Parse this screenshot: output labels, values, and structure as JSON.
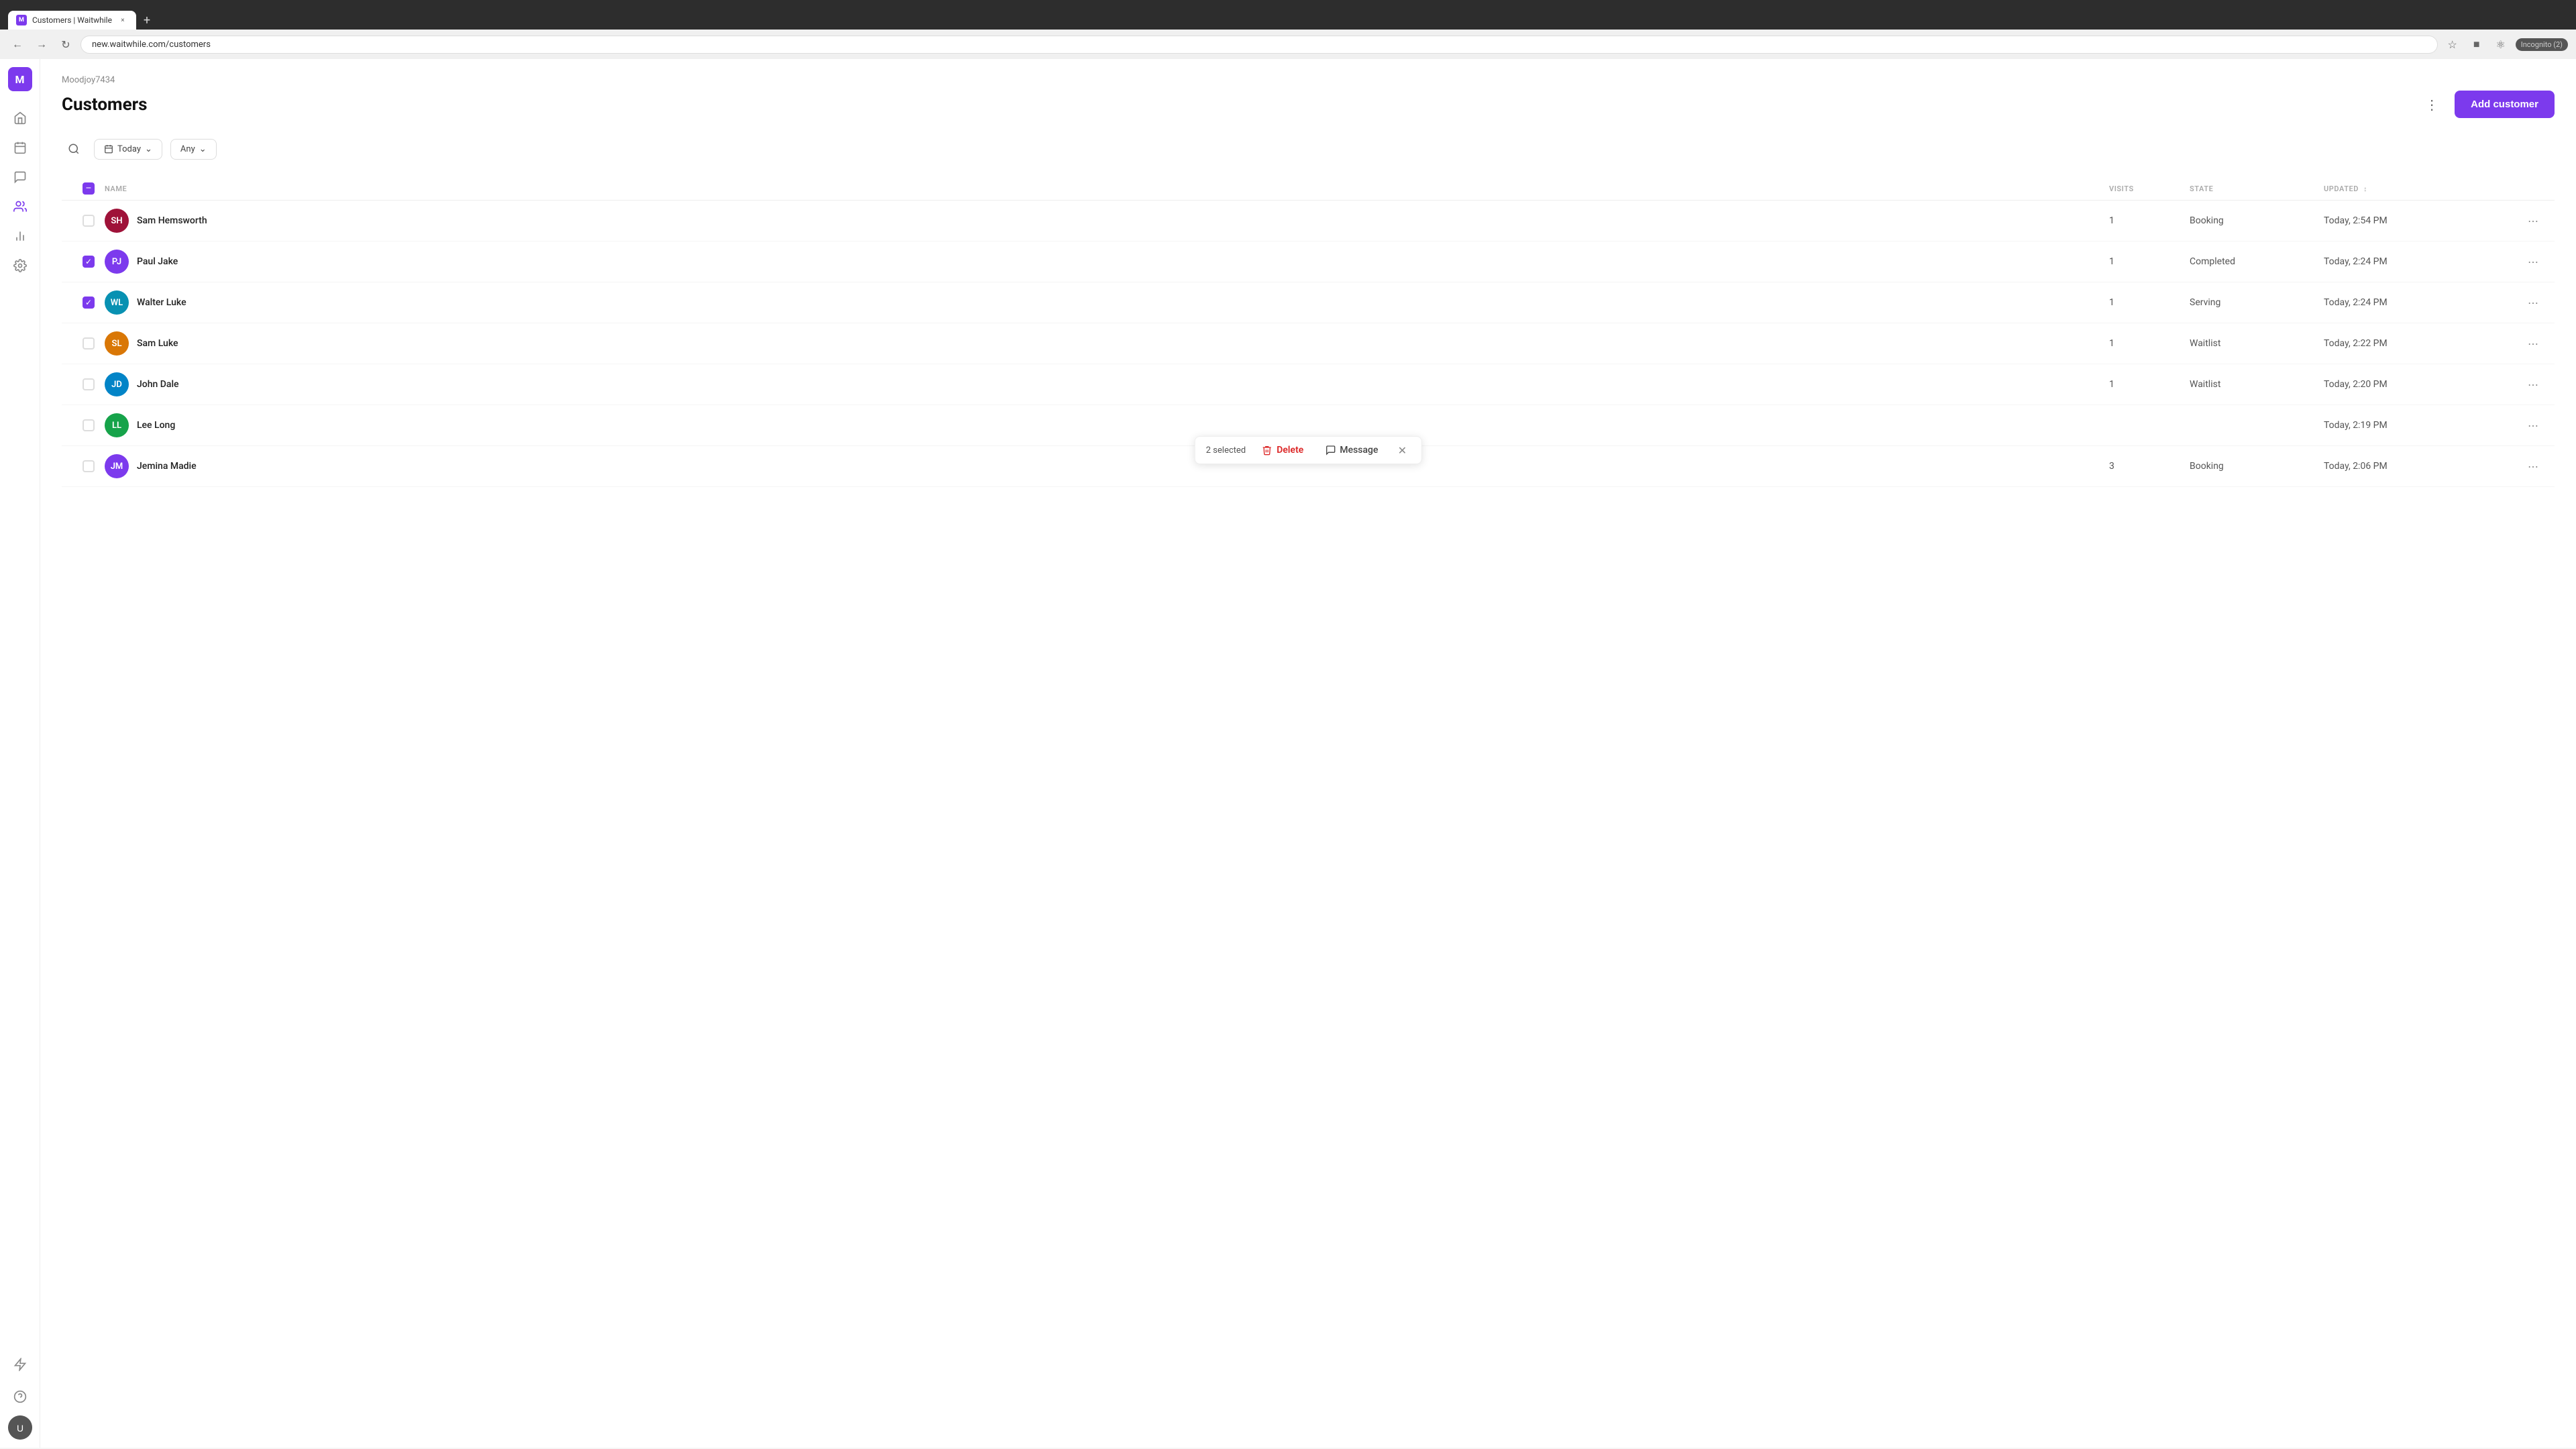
{
  "browser": {
    "tab_title": "Customers | Waitwhile",
    "tab_favicon": "M",
    "new_tab_label": "+",
    "address": "new.waitwhile.com/customers",
    "window_minimize": "—",
    "window_maximize": "□",
    "window_close": "×",
    "incognito_label": "Incognito (2)"
  },
  "workspace": {
    "label": "Moodjoy7434",
    "logo": "M"
  },
  "sidebar": {
    "items": [
      {
        "name": "home",
        "icon": "⌂",
        "active": false
      },
      {
        "name": "calendar",
        "icon": "▦",
        "active": false
      },
      {
        "name": "chat",
        "icon": "💬",
        "active": false
      },
      {
        "name": "customers",
        "icon": "👥",
        "active": true
      },
      {
        "name": "analytics",
        "icon": "📊",
        "active": false
      },
      {
        "name": "settings",
        "icon": "⚙",
        "active": false
      },
      {
        "name": "lightning",
        "icon": "⚡",
        "active": false
      },
      {
        "name": "help",
        "icon": "?",
        "active": false
      }
    ]
  },
  "page": {
    "title": "Customers",
    "add_customer_label": "Add customer"
  },
  "filters": {
    "search_placeholder": "Search",
    "date_filter": "Today",
    "any_filter": "Any"
  },
  "table": {
    "columns": {
      "name": "NAME",
      "visits": "VISITS",
      "state": "STATE",
      "updated": "UPDATED"
    },
    "rows": [
      {
        "id": "sam-hemsworth",
        "initials": "SH",
        "name": "Sam Hemsworth",
        "visits": "1",
        "state": "Booking",
        "updated": "Today, 2:54 PM",
        "avatar_color": "#9f1239",
        "checked": false
      },
      {
        "id": "paul-jake",
        "initials": "PJ",
        "name": "Paul Jake",
        "visits": "1",
        "state": "Completed",
        "updated": "Today, 2:24 PM",
        "avatar_color": "#7c3aed",
        "checked": true
      },
      {
        "id": "walter-luke",
        "initials": "WL",
        "name": "Walter Luke",
        "visits": "1",
        "state": "Serving",
        "updated": "Today, 2:24 PM",
        "avatar_color": "#0891b2",
        "checked": true
      },
      {
        "id": "sam-luke",
        "initials": "SL",
        "name": "Sam Luke",
        "visits": "1",
        "state": "Waitlist",
        "updated": "Today, 2:22 PM",
        "avatar_color": "#d97706",
        "checked": false
      },
      {
        "id": "john-dale",
        "initials": "JD",
        "name": "John Dale",
        "visits": "1",
        "state": "Waitlist",
        "updated": "Today, 2:20 PM",
        "avatar_color": "#0284c7",
        "checked": false
      },
      {
        "id": "lee-long",
        "initials": "LL",
        "name": "Lee Long",
        "visits": "",
        "state": "",
        "updated": "Today, 2:19 PM",
        "avatar_color": "#16a34a",
        "checked": false
      },
      {
        "id": "jemina-madie",
        "initials": "JM",
        "name": "Jemina Madie",
        "visits": "3",
        "state": "Booking",
        "updated": "Today, 2:06 PM",
        "avatar_color": "#7c3aed",
        "checked": false
      }
    ]
  },
  "bulk_action": {
    "selected_text": "2 selected",
    "delete_label": "Delete",
    "message_label": "Message"
  }
}
